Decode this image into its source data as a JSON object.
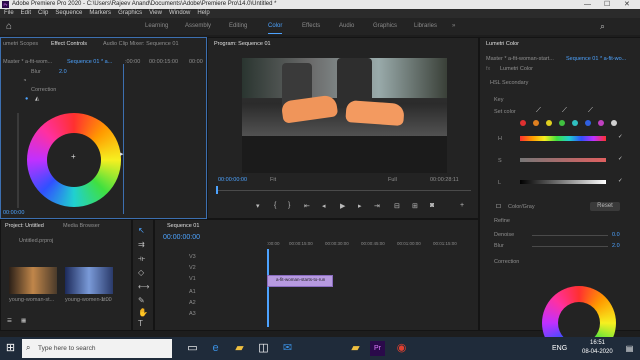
{
  "window": {
    "title": "Adobe Premiere Pro 2020 - C:\\Users\\Rajeev Anand\\Documents\\Adobe\\Premiere Pro\\14.0\\Untitled *",
    "app_icon_text": "Pr"
  },
  "menu": [
    "File",
    "Edit",
    "Clip",
    "Sequence",
    "Markers",
    "Graphics",
    "View",
    "Window",
    "Help"
  ],
  "workspaces": [
    {
      "label": "Learning"
    },
    {
      "label": "Assembly"
    },
    {
      "label": "Editing"
    },
    {
      "label": "Color",
      "active": true
    },
    {
      "label": "Effects"
    },
    {
      "label": "Audio"
    },
    {
      "label": "Graphics"
    },
    {
      "label": "Libraries"
    }
  ],
  "effect_controls": {
    "tabs": [
      "umetri Scopes",
      "Effect Controls",
      "Audio Clip Mixer: Sequence 01"
    ],
    "source": "Master * a-fit-wom...",
    "sequence": "Sequence 01 * a...",
    "time_start": ":00:00",
    "time_mid": "00:00:15:00",
    "time_end": "00:00",
    "blur_label": "Blur",
    "blur_value": "2.0",
    "correction_label": "Correction",
    "timecode": "00:00:00"
  },
  "program": {
    "tab": "Program: Sequence 01",
    "timecode": "00:00:00:00",
    "fit": "Fit",
    "quality": "Full",
    "duration": "00:00:28:11"
  },
  "lumetri": {
    "tab": "Lumetri Color",
    "source": "Master * a-fit-woman-start...",
    "sequence": "Sequence 01 * a-fit-wo...",
    "preset": "Lumetri Color",
    "section": "HSL Secondary",
    "key_label": "Key",
    "set_color": "Set color",
    "h": "H",
    "s": "S",
    "l": "L",
    "mode": "Color/Gray",
    "reset": "Reset",
    "refine": "Refine",
    "denoise_label": "Denoise",
    "denoise_value": "0.0",
    "blur_label": "Blur",
    "blur_value": "2.0",
    "correction": "Correction",
    "swatches": [
      "#e03030",
      "#e08020",
      "#e0d020",
      "#40c040",
      "#30c0c0",
      "#3060e0",
      "#c040c0",
      "#d0d0d0"
    ]
  },
  "project": {
    "tabs": [
      "Project: Untitled",
      "Media Browser"
    ],
    "file": "Untitled.prproj",
    "clips": [
      {
        "name": "young-woman-st...",
        "dur": ""
      },
      {
        "name": "young-women-st...",
        "dur": "1:00"
      }
    ]
  },
  "timeline": {
    "tab": "Sequence 01",
    "timecode": "00:00:00:00",
    "ruler": [
      ":00:00",
      "00:00:15:00",
      "00:00:30:00",
      "00:00:45:00",
      "00:01:00:00",
      "00:01:15:00"
    ],
    "tracks": [
      "V3",
      "V2",
      "V1",
      "A1",
      "A2",
      "A3"
    ],
    "clip_label": "a-fit-woman-starts-to-run"
  },
  "taskbar": {
    "search_placeholder": "Type here to search",
    "time": "16:51",
    "date": "08-04-2020",
    "lang": "ENG"
  }
}
